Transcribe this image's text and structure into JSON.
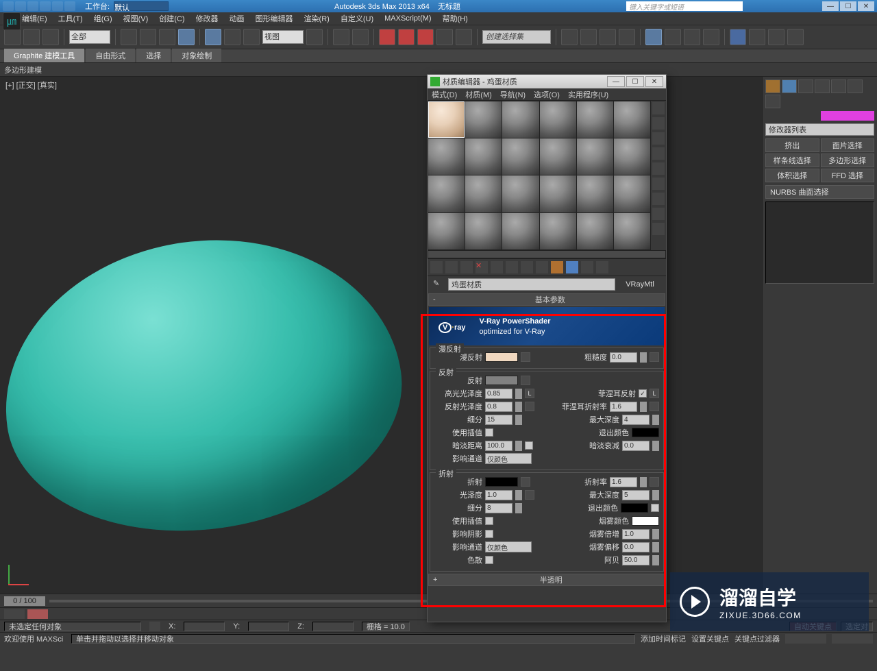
{
  "titlebar": {
    "workspace_label": "工作台:",
    "workspace_value": "默认",
    "app_title": "Autodesk 3ds Max  2013 x64",
    "doc_title": "无标题",
    "search_placeholder": "键入关键字或短语"
  },
  "menubar": [
    "编辑(E)",
    "工具(T)",
    "组(G)",
    "视图(V)",
    "创建(C)",
    "修改器",
    "动画",
    "图形编辑器",
    "渲染(R)",
    "自定义(U)",
    "MAXScript(M)",
    "帮助(H)"
  ],
  "toolbar": {
    "scope": "全部",
    "view_drop": "视图",
    "set_drop": "创建选择集"
  },
  "ribbon": {
    "tabs": [
      "Graphite 建模工具",
      "自由形式",
      "选择",
      "对象绘制"
    ],
    "sub": "多边形建模"
  },
  "viewport": {
    "label": "[+] [正交] [真实]"
  },
  "right_panel": {
    "modifier_list": "修改器列表",
    "buttons": [
      "挤出",
      "面片选择",
      "样条线选择",
      "多边形选择",
      "体积选择",
      "FFD 选择"
    ],
    "long_btn": "NURBS 曲面选择"
  },
  "mat_editor": {
    "title": "材质编辑器 - 鸡蛋材质",
    "menus": [
      "模式(D)",
      "材质(M)",
      "导航(N)",
      "选项(O)",
      "实用程序(U)"
    ],
    "name": "鸡蛋材质",
    "type": "VRayMtl",
    "rollout_basic": "基本参数",
    "rollout_trans": "半透明",
    "banner_logo_a": "V",
    "banner_logo_b": "ray",
    "banner_sub1": "V-Ray PowerShader",
    "banner_sub2": "optimized for V-Ray",
    "diffuse": {
      "legend": "漫反射",
      "label": "漫反射",
      "rough_label": "粗糙度",
      "rough": "0.0"
    },
    "reflect": {
      "legend": "反射",
      "label": "反射",
      "hilight_label": "高光光泽度",
      "hilight": "0.85",
      "refl_gloss_label": "反射光泽度",
      "refl_gloss": "0.8",
      "subdiv_label": "细分",
      "subdiv": "15",
      "interp_label": "使用插值",
      "dim_label": "暗淡距离",
      "dim": "100.0",
      "affect_label": "影响通道",
      "affect_val": "仅颜色",
      "fresnel_label": "菲涅耳反射",
      "fresnel_ior_label": "菲涅耳折射率",
      "fresnel_ior": "1.6",
      "maxdepth_label": "最大深度",
      "maxdepth": "4",
      "exitcolor_label": "退出颜色",
      "dim_falloff_label": "暗淡衰减",
      "dim_falloff": "0.0",
      "l_btn": "L"
    },
    "refract": {
      "legend": "折射",
      "label": "折射",
      "gloss_label": "光泽度",
      "gloss": "1.0",
      "subdiv_label": "细分",
      "subdiv": "8",
      "interp_label": "使用插值",
      "shadow_label": "影响阴影",
      "affect_label": "影响通道",
      "affect_val": "仅颜色",
      "disp_label": "色散",
      "ior_label": "折射率",
      "ior": "1.6",
      "maxdepth_label": "最大深度",
      "maxdepth": "5",
      "exitcolor_label": "退出颜色",
      "fogcolor_label": "烟雾颜色",
      "fogmult_label": "烟雾倍增",
      "fogmult": "1.0",
      "fogbias_label": "烟雾偏移",
      "fogbias": "0.0",
      "abbe_label": "阿贝",
      "abbe": "50.0"
    }
  },
  "timeline": {
    "pos": "0 / 100"
  },
  "status": {
    "sel": "未选定任何对象",
    "x": "X:",
    "y": "Y:",
    "z": "Z:",
    "grid": "栅格 = 10.0",
    "autokey": "自动关键点",
    "seldrop": "选定对"
  },
  "status2": {
    "welcome": "欢迎使用  MAXSci",
    "prompt": "单击并拖动以选择并移动对象",
    "addtime": "添加时间标记",
    "setkey": "设置关键点",
    "keyfilter": "关键点过滤器"
  },
  "watermark": {
    "big": "溜溜自学",
    "url": "ZIXUE.3D66.COM"
  }
}
